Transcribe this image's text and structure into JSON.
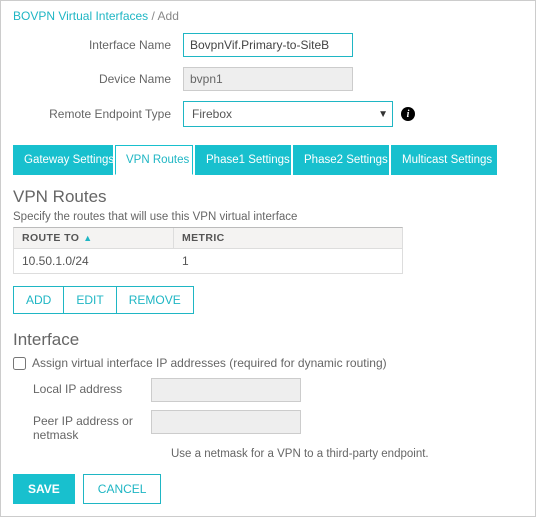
{
  "breadcrumb": {
    "root": "BOVPN Virtual Interfaces",
    "sep": "/",
    "current": "Add"
  },
  "form": {
    "interface_name_label": "Interface Name",
    "interface_name_value": "BovpnVif.Primary-to-SiteB",
    "device_name_label": "Device Name",
    "device_name_value": "bvpn1",
    "remote_endpoint_label": "Remote Endpoint Type",
    "remote_endpoint_value": "Firebox"
  },
  "tabs": {
    "gateway": "Gateway Settings",
    "vpn_routes": "VPN Routes",
    "phase1": "Phase1 Settings",
    "phase2": "Phase2 Settings",
    "multicast": "Multicast Settings"
  },
  "vpn_routes": {
    "heading": "VPN Routes",
    "desc": "Specify the routes that will use this VPN virtual interface",
    "col_route": "ROUTE TO",
    "col_metric": "METRIC",
    "rows": [
      {
        "route": "10.50.1.0/24",
        "metric": "1"
      }
    ],
    "add": "ADD",
    "edit": "EDIT",
    "remove": "REMOVE"
  },
  "interface": {
    "heading": "Interface",
    "checkbox_label": "Assign virtual interface IP addresses (required for dynamic routing)",
    "local_label": "Local IP address",
    "peer_label": "Peer IP address or netmask",
    "hint": "Use a netmask for a VPN to a third-party endpoint."
  },
  "footer": {
    "save": "SAVE",
    "cancel": "CANCEL"
  }
}
